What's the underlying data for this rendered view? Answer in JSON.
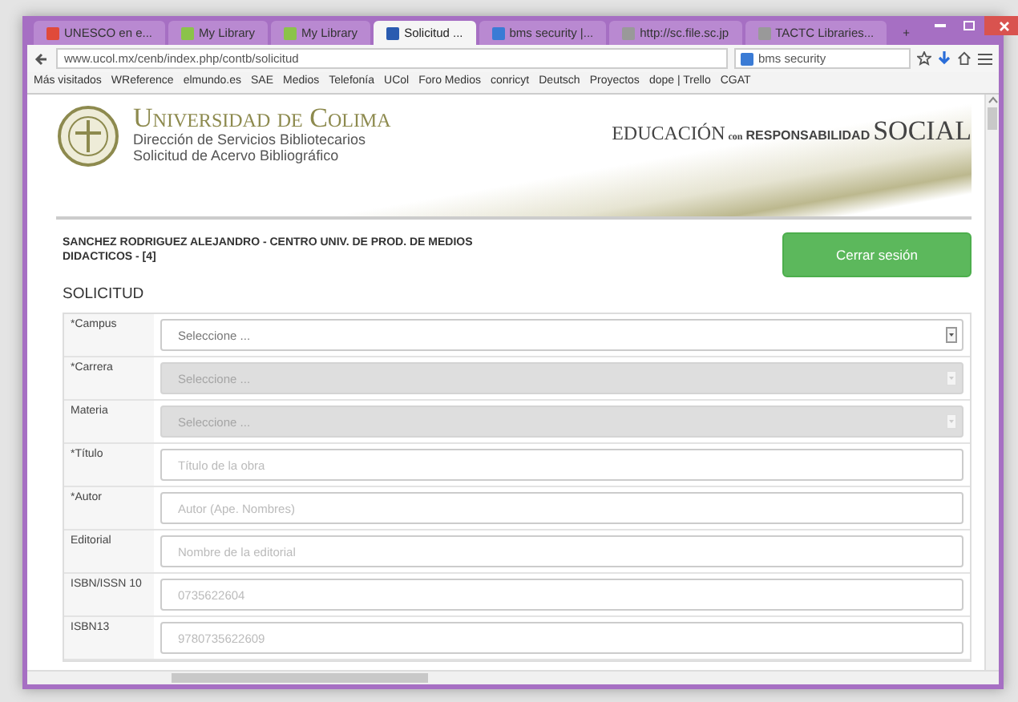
{
  "browser": {
    "tabs": [
      {
        "label": "UNESCO en e...",
        "selected": false
      },
      {
        "label": "My Library",
        "selected": false
      },
      {
        "label": "My Library",
        "selected": false
      },
      {
        "label": "Solicitud ...",
        "selected": true
      },
      {
        "label": "bms security |...",
        "selected": false
      },
      {
        "label": "http://sc.file.sc.jp",
        "selected": false
      },
      {
        "label": "TACTC Libraries...",
        "selected": false
      }
    ],
    "new_tab": "+",
    "url": "www.ucol.mx/cenb/index.php/contb/solicitud",
    "search": "bms security",
    "bookmarks": [
      "Más visitados",
      "WReference",
      "elmundo.es",
      "SAE",
      "Medios",
      "Telefonía",
      "UCol",
      "Foro Medios",
      "conricyt",
      "Deutsch",
      "Proyectos",
      "dope | Trello",
      "CGAT"
    ]
  },
  "header": {
    "university": "Universidad de Colima",
    "department": "Dirección de Servicios Bibliotecarios",
    "subtitle": "Solicitud de Acervo Bibliográfico",
    "slogan_1": "EDUCACIÓN",
    "slogan_2": "con",
    "slogan_3": "RESPONSABILIDAD",
    "slogan_4": "SOCIAL"
  },
  "user": "SANCHEZ RODRIGUEZ ALEJANDRO - CENTRO UNIV. DE PROD. DE MEDIOS DIDACTICOS - [4]",
  "logout_button": "Cerrar sesión",
  "section_title": "SOLICITUD",
  "form": [
    {
      "label": "*Campus",
      "kind": "select",
      "value": "Seleccione ...",
      "disabled": false
    },
    {
      "label": "*Carrera",
      "kind": "select",
      "value": "Seleccione ...",
      "disabled": true
    },
    {
      "label": "Materia",
      "kind": "select",
      "value": "Seleccione ...",
      "disabled": true
    },
    {
      "label": "*Título",
      "kind": "text",
      "placeholder": "Título de la obra"
    },
    {
      "label": "*Autor",
      "kind": "text",
      "placeholder": "Autor (Ape. Nombres)"
    },
    {
      "label": "Editorial",
      "kind": "text",
      "placeholder": "Nombre de la editorial"
    },
    {
      "label": "ISBN/ISSN 10",
      "kind": "text",
      "placeholder": "0735622604"
    },
    {
      "label": "ISBN13",
      "kind": "text",
      "placeholder": "9780735622609"
    }
  ]
}
